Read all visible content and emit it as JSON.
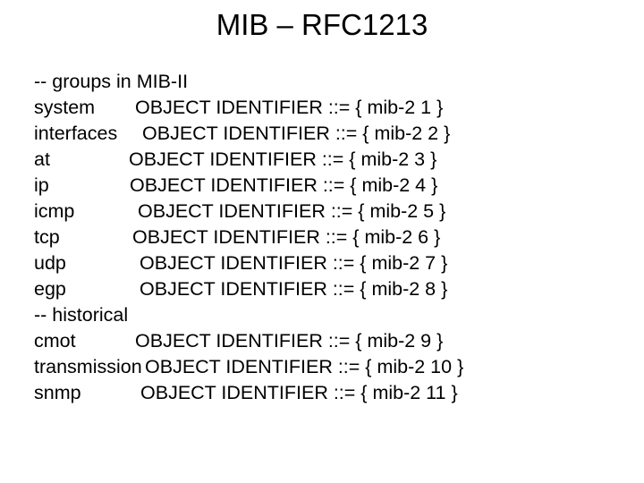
{
  "slide": {
    "title": "MIB – RFC1213",
    "background_color": "#ffffff",
    "text_color": "#000000"
  },
  "content": {
    "lines": [
      {
        "kind": "comment",
        "text": "-- groups in MIB-II"
      },
      {
        "kind": "entry",
        "name": "system",
        "label_width": 113,
        "declaration": "OBJECT IDENTIFIER ::= { mib-2 1 }",
        "type": "OBJECT IDENTIFIER",
        "assign": "::=",
        "oid": "{ mib-2 1 }",
        "parent": "mib-2",
        "index": "1"
      },
      {
        "kind": "entry",
        "name": "interfaces",
        "label_width": 121,
        "declaration": "OBJECT IDENTIFIER ::= { mib-2 2 }",
        "type": "OBJECT IDENTIFIER",
        "assign": "::=",
        "oid": "{ mib-2 2 }",
        "parent": "mib-2",
        "index": "2"
      },
      {
        "kind": "entry",
        "name": "at",
        "label_width": 106,
        "declaration": "OBJECT IDENTIFIER ::= { mib-2 3 }",
        "type": "OBJECT IDENTIFIER",
        "assign": "::=",
        "oid": "{ mib-2 3 }",
        "parent": "mib-2",
        "index": "3"
      },
      {
        "kind": "entry",
        "name": "ip",
        "label_width": 107,
        "declaration": "OBJECT IDENTIFIER ::= { mib-2 4 }",
        "type": "OBJECT IDENTIFIER",
        "assign": "::=",
        "oid": "{ mib-2 4 }",
        "parent": "mib-2",
        "index": "4"
      },
      {
        "kind": "entry",
        "name": "icmp",
        "label_width": 116,
        "declaration": "OBJECT IDENTIFIER ::= { mib-2 5 }",
        "type": "OBJECT IDENTIFIER",
        "assign": "::=",
        "oid": "{ mib-2 5 }",
        "parent": "mib-2",
        "index": "5"
      },
      {
        "kind": "entry",
        "name": "tcp",
        "label_width": 110,
        "declaration": "OBJECT IDENTIFIER ::= { mib-2 6 }",
        "type": "OBJECT IDENTIFIER",
        "assign": "::=",
        "oid": "{ mib-2 6 }",
        "parent": "mib-2",
        "index": "6"
      },
      {
        "kind": "entry",
        "name": "udp",
        "label_width": 118,
        "declaration": "OBJECT IDENTIFIER ::= { mib-2 7 }",
        "type": "OBJECT IDENTIFIER",
        "assign": "::=",
        "oid": "{ mib-2 7 }",
        "parent": "mib-2",
        "index": "7"
      },
      {
        "kind": "entry",
        "name": "egp",
        "label_width": 118,
        "declaration": "OBJECT IDENTIFIER ::= { mib-2 8 }",
        "type": "OBJECT IDENTIFIER",
        "assign": "::=",
        "oid": "{ mib-2 8 }",
        "parent": "mib-2",
        "index": "8"
      },
      {
        "kind": "comment",
        "text": "-- historical"
      },
      {
        "kind": "entry",
        "name": "cmot",
        "label_width": 113,
        "declaration": "OBJECT IDENTIFIER ::= { mib-2 9 }",
        "type": "OBJECT IDENTIFIER",
        "assign": "::=",
        "oid": "{ mib-2 9 }",
        "parent": "mib-2",
        "index": "9"
      },
      {
        "kind": "entry",
        "name": "transmission",
        "label_width": 124,
        "declaration": "OBJECT IDENTIFIER ::= { mib-2 10 }",
        "type": "OBJECT IDENTIFIER",
        "assign": "::=",
        "oid": "{ mib-2 10 }",
        "parent": "mib-2",
        "index": "10"
      },
      {
        "kind": "entry",
        "name": "snmp",
        "label_width": 119,
        "declaration": "OBJECT IDENTIFIER ::= { mib-2 11 }",
        "type": "OBJECT IDENTIFIER",
        "assign": "::=",
        "oid": "{ mib-2 11 }",
        "parent": "mib-2",
        "index": "11"
      }
    ]
  }
}
